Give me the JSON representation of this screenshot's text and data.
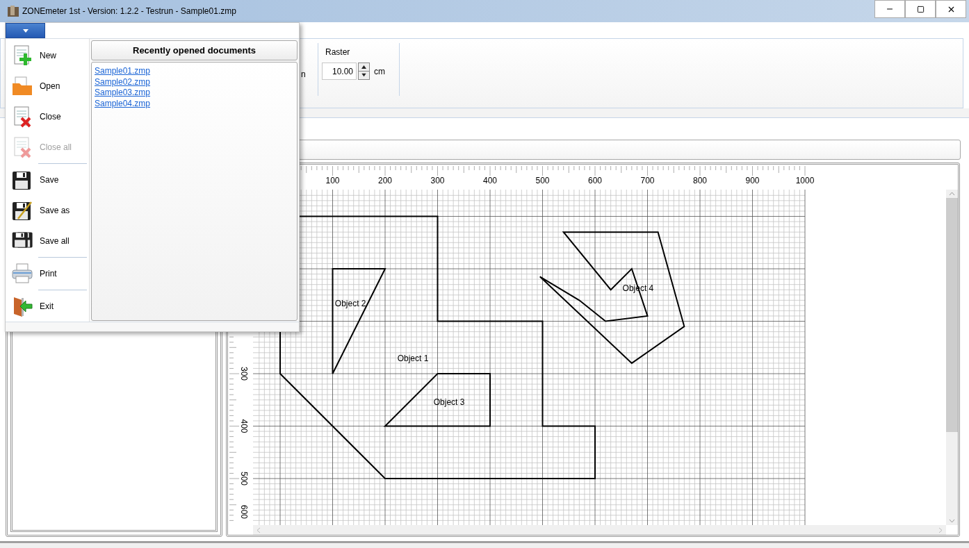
{
  "window": {
    "title": "ZONEmeter 1st - Version: 1.2.2 - Testrun - Sample01.zmp"
  },
  "ribbon": {
    "cut_text": "n",
    "groups": [
      {
        "label": "Raster",
        "value": "10.00",
        "unit": "cm"
      }
    ]
  },
  "app_menu": {
    "open": true,
    "commands": [
      {
        "kind": "command",
        "label": "New",
        "disabled": false
      },
      {
        "kind": "command",
        "label": "Open",
        "disabled": false
      },
      {
        "kind": "command",
        "label": "Close",
        "disabled": false
      },
      {
        "kind": "command",
        "label": "Close all",
        "disabled": true
      },
      {
        "kind": "separator"
      },
      {
        "kind": "command",
        "label": "Save",
        "disabled": false
      },
      {
        "kind": "command",
        "label": "Save as",
        "disabled": false
      },
      {
        "kind": "command",
        "label": "Save all",
        "disabled": false
      },
      {
        "kind": "separator"
      },
      {
        "kind": "command",
        "label": "Print",
        "disabled": false
      },
      {
        "kind": "separator"
      },
      {
        "kind": "command",
        "label": "Exit",
        "disabled": false
      }
    ],
    "recent": {
      "title": "Recently opened documents",
      "documents": [
        "Sample01.zmp",
        "Sample02.zmp",
        "Sample03.zmp",
        "Sample04.zmp"
      ]
    }
  },
  "canvas": {
    "x_ruler": [
      "100",
      "200",
      "300",
      "400",
      "500",
      "600",
      "700",
      "800",
      "900",
      "1000"
    ],
    "y_ruler": [
      "300",
      "400",
      "500",
      "600"
    ],
    "objects": [
      {
        "label": "Object 1"
      },
      {
        "label": "Object 2"
      },
      {
        "label": "Object 3"
      },
      {
        "label": "Object 4"
      }
    ]
  }
}
